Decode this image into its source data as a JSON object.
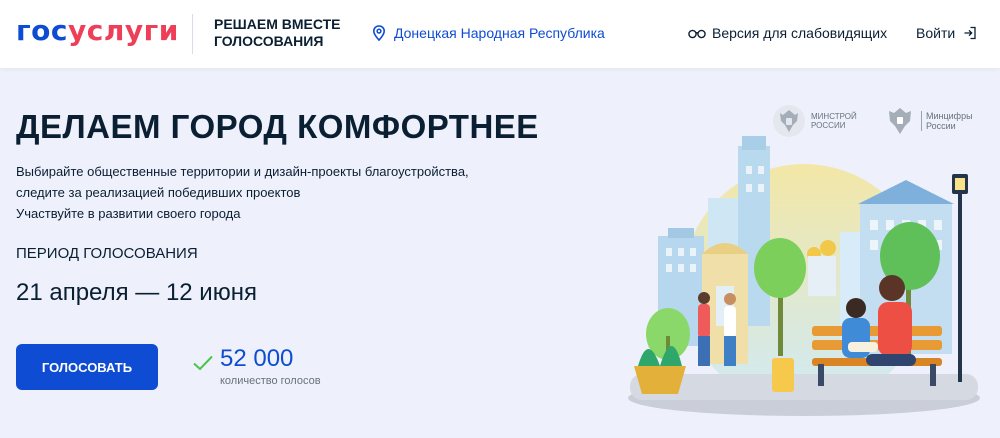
{
  "header": {
    "logo_part1": "гос",
    "logo_part2": "услуги",
    "slogan": "РЕШАЕМ ВМЕСТЕ ГОЛОСОВАНИЯ",
    "region": "Донецкая Народная Республика",
    "vision_label": "Версия для слабовидящих",
    "login_label": "Войти"
  },
  "hero": {
    "title": "ДЕЛАЕМ ГОРОД КОМФОРТНЕЕ",
    "description_lines": [
      "Выбирайте общественные территории и дизайн-проекты благоустройства,",
      "следите за реализацией победивших проектов",
      "Участвуйте в развитии своего города"
    ],
    "period_label": "ПЕРИОД ГОЛОСОВАНИЯ",
    "period_dates": "21 апреля — 12 июня",
    "vote_button": "ГОЛОСОВАТЬ",
    "votes_count": "52 000",
    "votes_caption": "количество голосов"
  },
  "partners": {
    "minstroy_line1": "МИНСТРОЙ",
    "minstroy_line2": "РОССИИ",
    "mincifry_line1": "Минцифры",
    "mincifry_line2": "России"
  },
  "colors": {
    "brand_blue": "#0d4cd3",
    "brand_red": "#ee3f58",
    "background": "#eef1fb",
    "check_green": "#4bc44b"
  },
  "icons": [
    "map-pin-icon",
    "glasses-icon",
    "login-arrow-icon",
    "check-icon",
    "emblem-icon"
  ]
}
